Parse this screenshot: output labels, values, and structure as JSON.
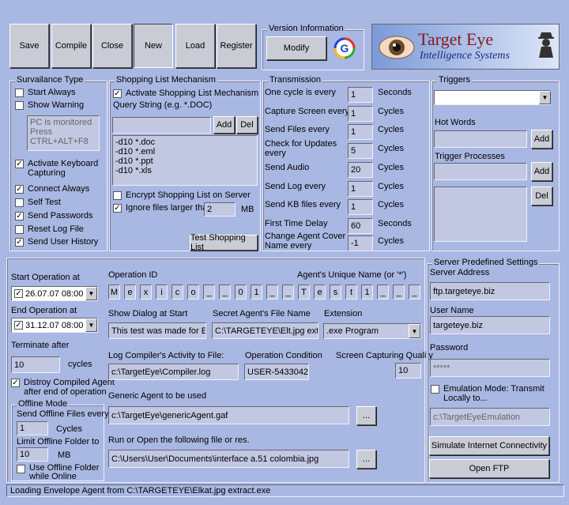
{
  "toolbar": {
    "save": "Save",
    "compile": "Compile",
    "close": "Close",
    "new": "New",
    "load": "Load",
    "register": "Register"
  },
  "version": {
    "title": "Version Information",
    "modify": "Modify"
  },
  "logo": {
    "line1": "Target Eye",
    "line2": "Intelligence Systems"
  },
  "survailance": {
    "title": "Survailance Type",
    "start_always": "Start Always",
    "show_warning": "Show Warning",
    "warning_text": "PC is monitored\nPress\nCTRL+ALT+F8",
    "activate_keyboard": "Activate Keyboard\nCapturing",
    "connect_always": "Connect Always",
    "self_test": "Self Test",
    "send_passwords": "Send Passwords",
    "reset_log": "Reset Log File",
    "send_history": "Send User History"
  },
  "shopping": {
    "title": "Shopping List Mechanism",
    "activate": "Activate Shopping List Mechanism",
    "query_label": "Query String (e.g. *.DOC)",
    "add": "Add",
    "del": "Del",
    "items": "-d10 *.doc\n-d10 *.eml\n-d10 *.ppt\n-d10 *.xls",
    "encrypt": "Encrypt Shopping List on Server",
    "ignore": "Ignore files larger than",
    "ignore_value": "2",
    "ignore_unit": "MB",
    "test": "Test Shopping List"
  },
  "transmission": {
    "title": "Transmission",
    "rows": [
      {
        "label": "One cycle is every",
        "value": "1",
        "unit": "Seconds"
      },
      {
        "label": "Capture Screen every",
        "value": "1",
        "unit": "Cycles"
      },
      {
        "label": "Send Files every",
        "value": "1",
        "unit": "Cycles"
      },
      {
        "label": "Check for Updates\nevery",
        "value": "5",
        "unit": "Cycles"
      },
      {
        "label": "Send Audio",
        "value": "20",
        "unit": "Cycles"
      },
      {
        "label": "Send Log every",
        "value": "1",
        "unit": "Cycles"
      },
      {
        "label": "Send KB files every",
        "value": "1",
        "unit": "Cycles"
      },
      {
        "label": "First Time Delay",
        "value": "60",
        "unit": "Seconds"
      },
      {
        "label": "Change Agent Cover\nName every",
        "value": "-1",
        "unit": "Cycles"
      }
    ]
  },
  "triggers": {
    "title": "Triggers",
    "hot_words": "Hot Words",
    "add": "Add",
    "trigger_processes": "Trigger Processes",
    "add2": "Add",
    "del": "Del"
  },
  "operation": {
    "start_label": "Start Operation at",
    "start_value": "26.07.07 08:00",
    "end_label": "End Operation at",
    "end_value": "31.12.07 08:00",
    "terminate_label": "Terminate after",
    "terminate_value": "10",
    "terminate_unit": "cycles",
    "distroy": "Distroy Compiled Agent\nafter end of operation"
  },
  "offline": {
    "title": "Offline Mode",
    "send_label": "Send Offline Files every",
    "send_value": "1",
    "send_unit": "Cycles",
    "limit_label": "Limit Offline Folder to",
    "limit_value": "10",
    "limit_unit": "MB",
    "use_folder": "Use Offline Folder\nwhile Online"
  },
  "opid": {
    "label": "Operation ID",
    "chars": [
      "M",
      "e",
      "x",
      "i",
      "c",
      "o",
      "_",
      "_",
      "0",
      "1",
      "_",
      "_"
    ],
    "unique_label": "Agent's Unique Name (or '*')",
    "unique_chars": [
      "T",
      "e",
      "s",
      "t",
      "1",
      "_",
      "_",
      "_"
    ]
  },
  "dialog": {
    "label": "Show Dialog at Start",
    "value": "This test was made for Elkat"
  },
  "secret": {
    "label": "Secret Agent's File Name",
    "value": "C:\\TARGETEYE\\Elt.jpg extract"
  },
  "extension": {
    "label": "Extension",
    "value": ".exe Program"
  },
  "logfile": {
    "label": "Log Compiler's Activity to File:",
    "value": "c:\\TargetEye\\Compiler.log"
  },
  "condition": {
    "label": "Operation Condition",
    "value": "USER-5433042"
  },
  "quality": {
    "label": "Screen Capturing Quality",
    "value": "10"
  },
  "generic": {
    "label": "Generic Agent to be used",
    "value": "c:\\TargetEye\\genericAgent.gaf",
    "browse": "..."
  },
  "runopen": {
    "label": "Run or Open the following file or res.",
    "value": "C:\\Users\\User\\Documents\\interface a.51 colombia.jpg",
    "browse": "..."
  },
  "server": {
    "title": "Server Predefined Settings",
    "address_label": "Server Address",
    "address_value": "ftp.targeteye.biz",
    "user_label": "User Name",
    "user_value": "targeteye.biz",
    "password_label": "Password",
    "password_value": "*****",
    "emulation": "Emulation Mode: Transmit\nLocally to...",
    "emulation_path": "c:\\TargetEyeEmulation",
    "simulate": "Simulate Internet Connectivity",
    "open_ftp": "Open FTP"
  },
  "status": "Loading Envelope Agent from C:\\TARGETEYE\\Elkat.jpg extract.exe"
}
